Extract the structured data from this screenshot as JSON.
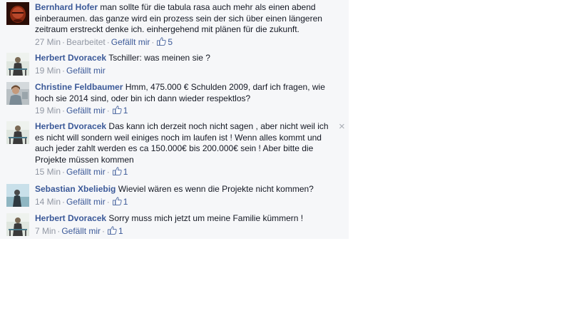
{
  "separator": "·",
  "comments": [
    {
      "author": "Bernhard Hofer",
      "text_lines": [
        "man sollte für die tabula rasa auch mehr als einen abend",
        "einberaumen. das ganze wird ein prozess sein der sich über einen längeren",
        "zeitraum erstreckt denke ich. einhergehend mit plänen für die zukunft."
      ],
      "time": "27 Min",
      "edited": "Bearbeitet",
      "like_label": "Gefällt mir",
      "likes": "5",
      "avatar": "avatar-bernhard"
    },
    {
      "author": "Herbert Dvoracek",
      "text_lines": [
        "Tschiller: was meinen sie ?"
      ],
      "time": "19 Min",
      "like_label": "Gefällt mir",
      "likes": "",
      "avatar": "avatar-herbert"
    },
    {
      "author": "Christine Feldbaumer",
      "text_lines": [
        "Hmm, 475.000 € Schulden 2009, darf ich fragen, wie",
        "hoch sie 2014 sind, oder bin ich dann wieder respektlos?"
      ],
      "time": "19 Min",
      "like_label": "Gefällt mir",
      "likes": "1",
      "avatar": "avatar-christine"
    },
    {
      "author": "Herbert Dvoracek",
      "text_lines": [
        "Das kann ich derzeit noch nicht sagen , aber nicht weil ich",
        "es nicht will sondern weil einiges noch im laufen ist ! Wenn alles kommt und",
        "auch jeder zahlt werden es ca 150.000€ bis 200.000€ sein ! Aber bitte die",
        "Projekte müssen kommen"
      ],
      "time": "15 Min",
      "like_label": "Gefällt mir",
      "likes": "1",
      "avatar": "avatar-herbert",
      "close": "×"
    },
    {
      "author": "Sebastian Xbeliebig",
      "text_lines": [
        "Wieviel wären es wenn die Projekte nicht kommen?"
      ],
      "time": "14 Min",
      "like_label": "Gefällt mir",
      "likes": "1",
      "avatar": "avatar-sebastian"
    },
    {
      "author": "Herbert Dvoracek",
      "text_lines": [
        "Sorry muss mich jetzt um meine Familie kümmern !"
      ],
      "time": "7 Min",
      "like_label": "Gefällt mir",
      "likes": "1",
      "avatar": "avatar-herbert"
    }
  ],
  "colors": {
    "author": "#3b5998",
    "meta": "#9197a3",
    "panel": "#f6f7f9"
  }
}
